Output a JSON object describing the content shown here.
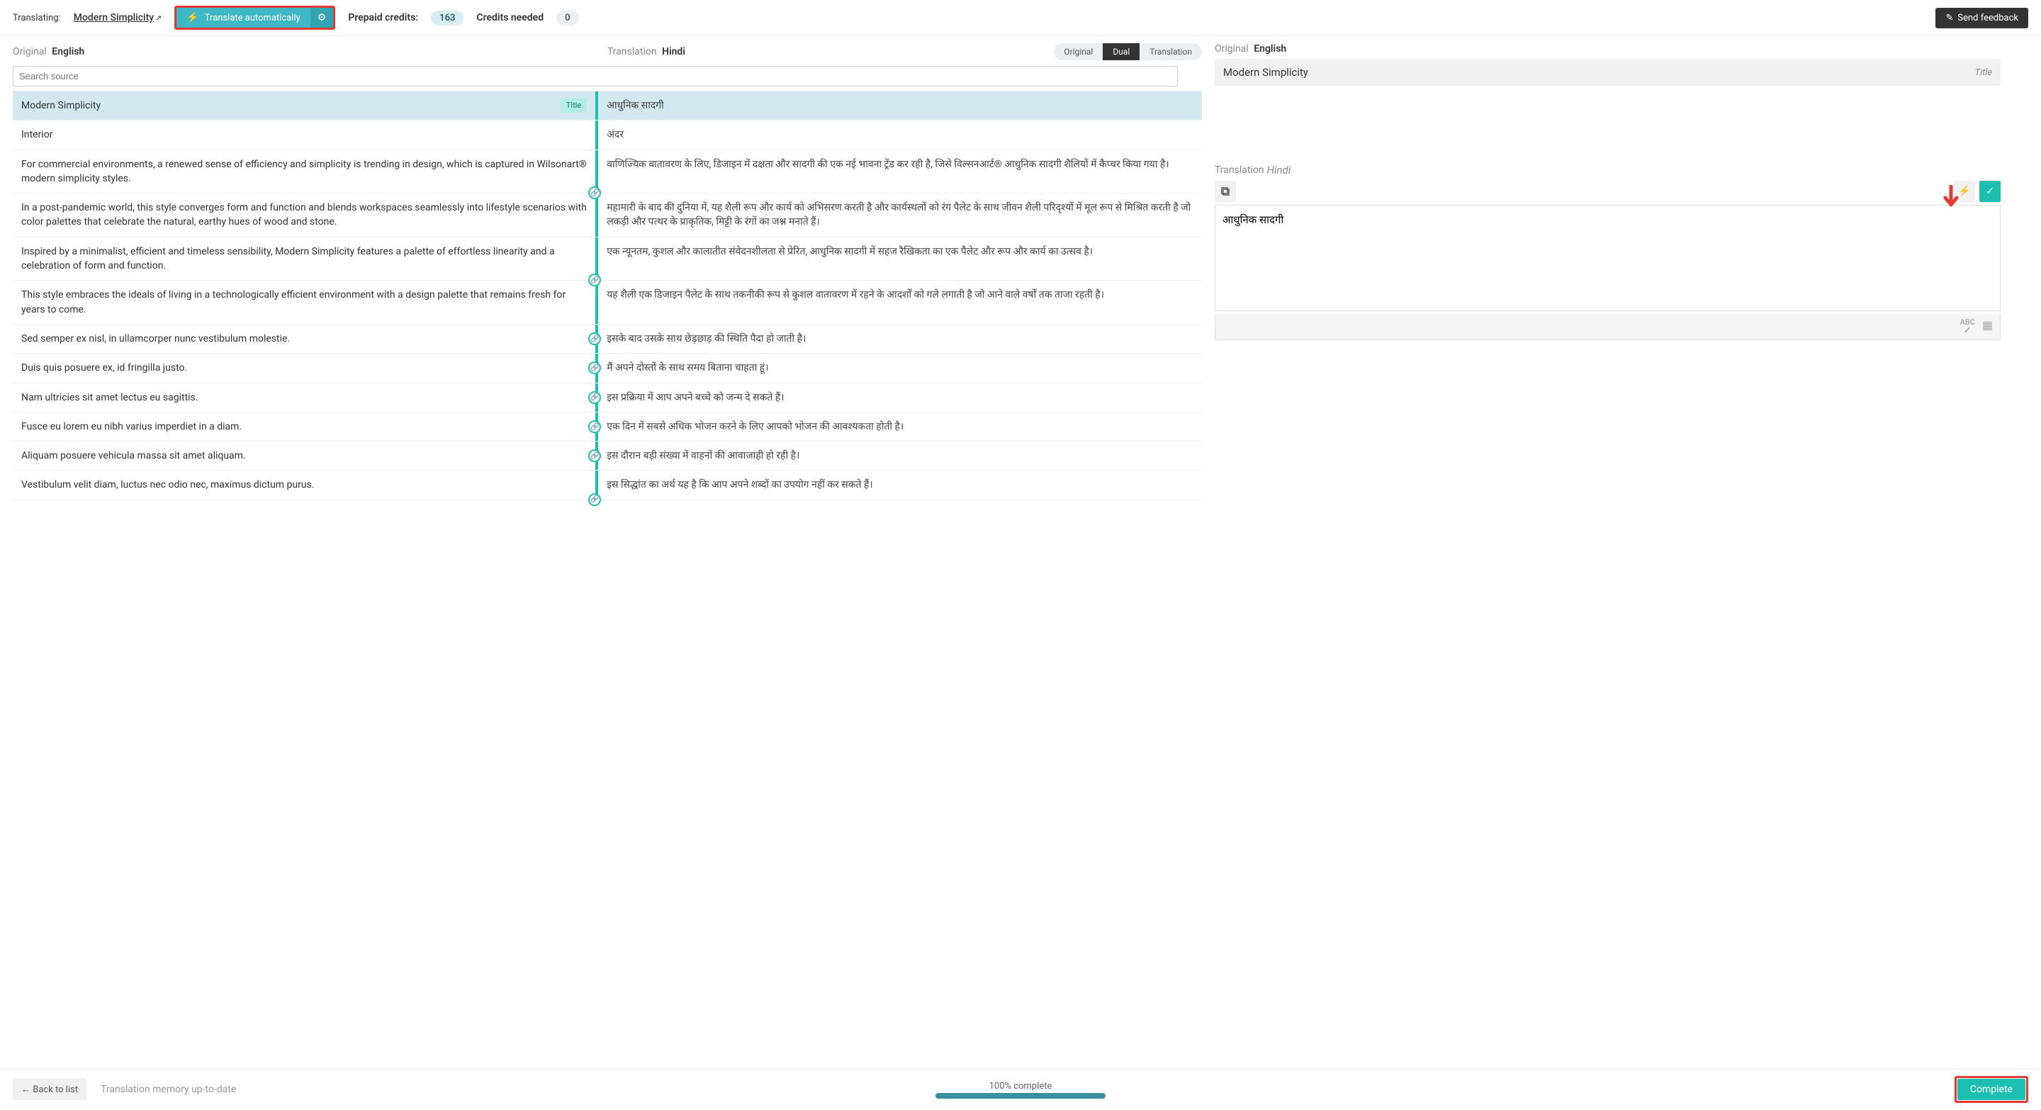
{
  "topbar": {
    "translating_label": "Translating:",
    "doc_name": "Modern Simplicity",
    "translate_auto": "Translate automatically",
    "prepaid_label": "Prepaid credits:",
    "prepaid_value": "163",
    "needed_label": "Credits needed",
    "needed_value": "0",
    "feedback": "Send feedback"
  },
  "headers": {
    "original_label": "Original",
    "original_lang": "English",
    "translation_label": "Translation",
    "translation_lang": "Hindi",
    "view_original": "Original",
    "view_dual": "Dual",
    "view_translation": "Translation",
    "search_placeholder": "Search source"
  },
  "rows": [
    {
      "src": "Modern Simplicity",
      "tgt": "आधुनिक सादगी",
      "title": true,
      "selected": true
    },
    {
      "src": "Interior",
      "tgt": "अंदर"
    },
    {
      "src": "For commercial environments, a renewed sense of efficiency and simplicity is trending in design, which is captured in Wilsonart® modern simplicity styles.",
      "tgt": "वाणिज्यिक वातावरण के लिए, डिजाइन में दक्षता और सादगी की एक नई भावना ट्रेंड कर रही है, जिसे विल्सनआर्ट® आधुनिक सादगी शैलियों में कैप्चर किया गया है।",
      "link_bottom": true
    },
    {
      "src": "In a post-pandemic world, this style converges form and function and blends workspaces seamlessly into lifestyle scenarios with color palettes that celebrate the natural, earthy hues of wood and stone.",
      "tgt": "महामारी के बाद की दुनिया में, यह शैली रूप और कार्य को अभिसरण करती है और कार्यस्थलों को रंग पैलेट के साथ जीवन शैली परिदृश्यों में मूल रूप से मिश्रित करती है जो लकड़ी और पत्थर के प्राकृतिक, मिट्टी के रंगों का जश्न मनाते हैं।"
    },
    {
      "src": "Inspired by a minimalist, efficient and timeless sensibility, Modern Simplicity features a palette of effortless linearity and a celebration of form and function.",
      "tgt": "एक न्यूनतम, कुशल और कालातीत संवेदनशीलता से प्रेरित, आधुनिक सादगी में सहज रैखिकता का एक पैलेट और रूप और कार्य का उत्सव है।",
      "link_bottom": true
    },
    {
      "src": "This style embraces the ideals of living in a technologically efficient environment with a design palette that remains fresh for years to come.",
      "tgt": "यह शैली एक डिजाइन पैलेट के साथ तकनीकी रूप से कुशल वातावरण में रहने के आदर्शों को गले लगाती है जो आने वाले वर्षों तक ताजा रहती है।"
    },
    {
      "src": "Sed semper ex nisl, in ullamcorper nunc vestibulum molestie.",
      "tgt": "इसके बाद उसके साथ छेड़छाड़ की स्थिति पैदा हो जाती है।",
      "link_mid": true
    },
    {
      "src": "Duis quis posuere ex, id fringilla justo.",
      "tgt": "मैं अपने दोस्तों के साथ समय बिताना चाहता हूं।",
      "link_mid": true
    },
    {
      "src": "Nam ultricies sit amet lectus eu sagittis.",
      "tgt": "इस प्रक्रिया में आप अपने बच्चे को जन्म दे सकते हैं।",
      "link_mid": true
    },
    {
      "src": "Fusce eu lorem eu nibh varius imperdiet in a diam.",
      "tgt": "एक दिन में सबसे अधिक भोजन करने के लिए आपको भोजन की आवश्यकता होती है।",
      "link_mid": true
    },
    {
      "src": "Aliquam posuere vehicula massa sit amet aliquam.",
      "tgt": "इस दौरान बड़ी संख्या में वाहनों की आवाजाही हो रही है।",
      "link_mid": true
    },
    {
      "src": "Vestibulum velit diam, luctus nec odio nec, maximus dictum purus.",
      "tgt": "इस सिद्धांत का अर्थ यह है कि आप अपने शब्दों का उपयोग नहीं कर सकते हैं।",
      "link_bottom": true
    }
  ],
  "detail": {
    "original_label": "Original",
    "original_lang": "English",
    "title_text": "Modern Simplicity",
    "title_badge": "Title",
    "translation_label": "Translation",
    "translation_lang": "Hindi",
    "translation_value": "आधुनिक सादगी"
  },
  "bottom": {
    "back": "Back to list",
    "memory": "Translation memory up-to-date",
    "progress_text": "100% complete",
    "complete": "Complete"
  },
  "badges": {
    "title": "Title"
  }
}
